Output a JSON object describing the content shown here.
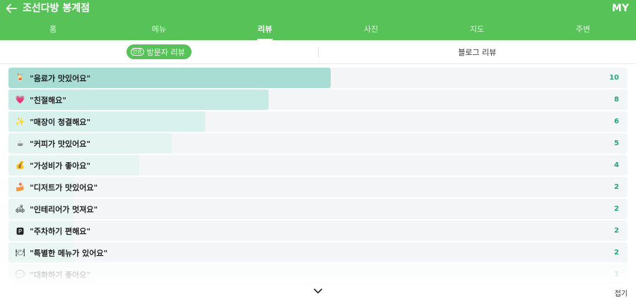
{
  "header": {
    "title": "조선다방 봉계점",
    "my_label": "MY",
    "back_icon": "arrow-left-icon"
  },
  "tabs": [
    {
      "label": "홈",
      "active": false
    },
    {
      "label": "메뉴",
      "active": false
    },
    {
      "label": "리뷰",
      "active": true
    },
    {
      "label": "사진",
      "active": false
    },
    {
      "label": "지도",
      "active": false
    },
    {
      "label": "주변",
      "active": false
    }
  ],
  "subtabs": {
    "visitor": {
      "badge": "인증",
      "label": "방문자 리뷰",
      "active": true
    },
    "blog": {
      "label": "블로그 리뷰",
      "active": false
    }
  },
  "keywords": [
    {
      "icon": "drink-icon",
      "glyph": "🍹",
      "label": "\"음료가 맛있어요\"",
      "count": "10",
      "ratio": 0.52,
      "color": "#a8ddd4"
    },
    {
      "icon": "heart-icon",
      "glyph": "💗",
      "label": "\"친절해요\"",
      "count": "8",
      "ratio": 0.42,
      "color": "#c6ebe5"
    },
    {
      "icon": "sparkle-icon",
      "glyph": "✨",
      "label": "\"매장이 청결해요\"",
      "count": "6",
      "ratio": 0.317,
      "color": "#d9f1ed"
    },
    {
      "icon": "coffee-icon",
      "glyph": "☕",
      "label": "\"커피가 맛있어요\"",
      "count": "5",
      "ratio": 0.264,
      "color": "#e4f5f1"
    },
    {
      "icon": "money-icon",
      "glyph": "💰",
      "label": "\"가성비가 좋아요\"",
      "count": "4",
      "ratio": 0.211,
      "color": "#e6f5f2"
    },
    {
      "icon": "cake-icon",
      "glyph": "🍰",
      "label": "\"디저트가 맛있어요\"",
      "count": "2",
      "ratio": 0.105,
      "color": "#eaf6f3"
    },
    {
      "icon": "sofa-icon",
      "glyph": "🛋",
      "label": "\"인테리어가 멋져요\"",
      "count": "2",
      "ratio": 0.105,
      "color": "#eaf6f3"
    },
    {
      "icon": "parking-icon",
      "glyph": "🅿",
      "label": "\"주차하기 편해요\"",
      "count": "2",
      "ratio": 0.105,
      "color": "#eaf6f3"
    },
    {
      "icon": "special-menu-icon",
      "glyph": "🍽",
      "label": "\"특별한 메뉴가 있어요\"",
      "count": "2",
      "ratio": 0.105,
      "color": "#eaf6f3"
    },
    {
      "icon": "chat-icon",
      "glyph": "💬",
      "label": "\"대화하기 좋아요\"",
      "count": "1",
      "ratio": 0.053,
      "color": "#eaf6f3"
    }
  ],
  "footer": {
    "expand_icon": "chevron-down-icon",
    "collapse_label": "접기"
  }
}
